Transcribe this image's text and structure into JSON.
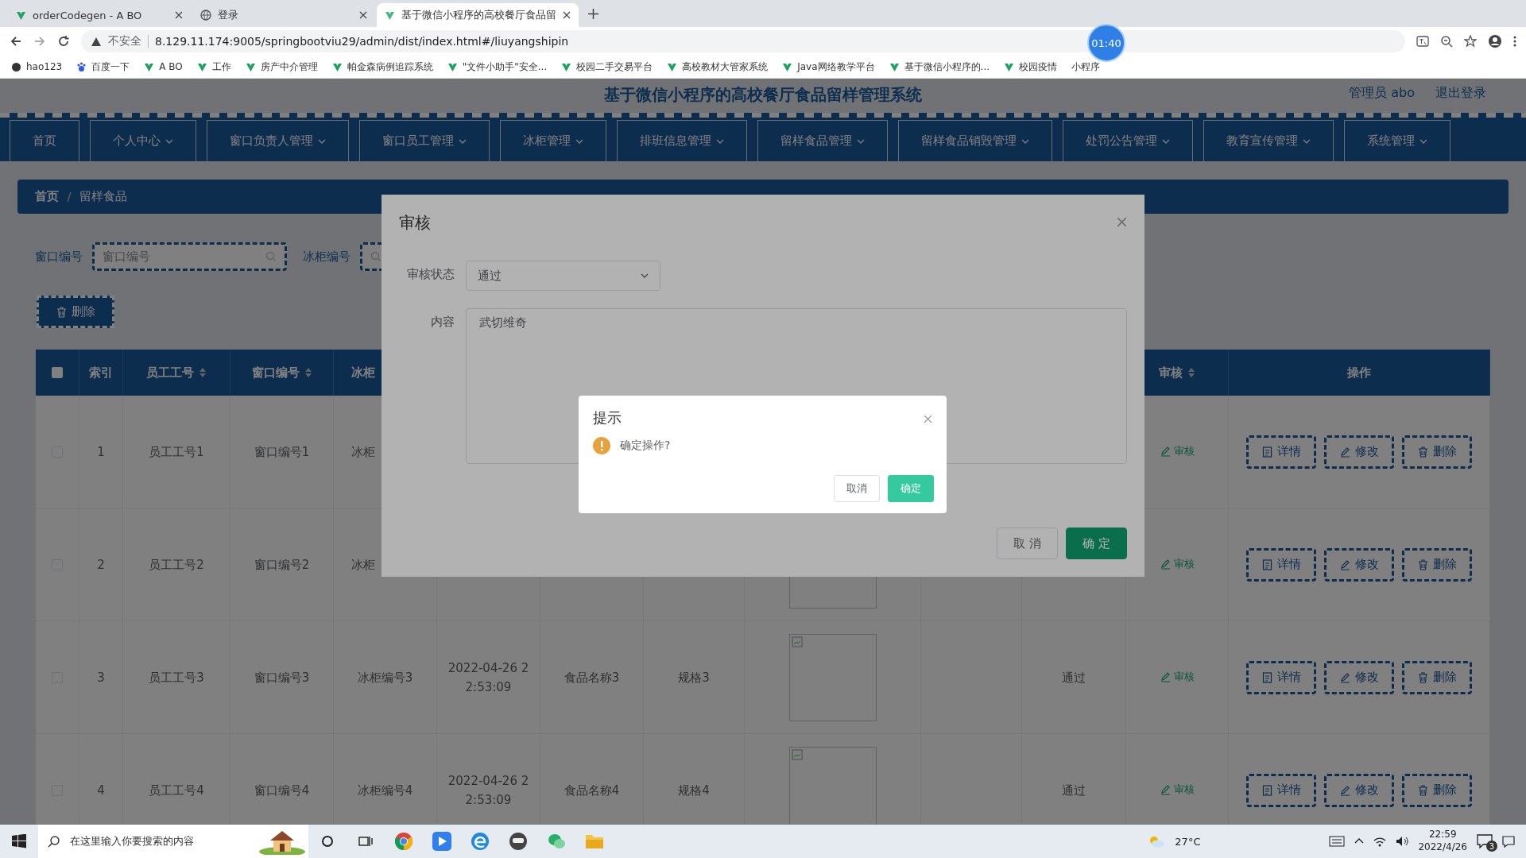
{
  "browser": {
    "tabs": [
      {
        "title": "orderCodegen - A BO",
        "selected": false
      },
      {
        "title": "登录",
        "selected": false
      },
      {
        "title": "基于微信小程序的高校餐厅食品留",
        "selected": true
      }
    ],
    "security": "不安全",
    "url": "8.129.11.174:9005/springbootviu29/admin/dist/index.html#/liuyangshipin",
    "bookmarks": [
      "hao123",
      "百度一下",
      "A BO",
      "工作",
      "房产中介管理",
      "帕金森病例追踪系统",
      "\"文件小助手\"安全...",
      "校园二手交易平台",
      "高校教材大管家系统",
      "Java网络教学平台",
      "基于微信小程序的...",
      "校园疫情",
      "小程序"
    ],
    "recording_timer": "01:40"
  },
  "header": {
    "title": "基于微信小程序的高校餐厅食品留样管理系统",
    "user": "管理员 abo",
    "logout": "退出登录"
  },
  "nav": [
    {
      "label": "首页",
      "dropdown": false
    },
    {
      "label": "个人中心",
      "dropdown": true
    },
    {
      "label": "窗口负责人管理",
      "dropdown": true
    },
    {
      "label": "窗口员工管理",
      "dropdown": true
    },
    {
      "label": "冰柜管理",
      "dropdown": true
    },
    {
      "label": "排班信息管理",
      "dropdown": true
    },
    {
      "label": "留样食品管理",
      "dropdown": true
    },
    {
      "label": "留样食品销毁管理",
      "dropdown": true
    },
    {
      "label": "处罚公告管理",
      "dropdown": true
    },
    {
      "label": "教育宣传管理",
      "dropdown": true
    },
    {
      "label": "系统管理",
      "dropdown": true
    }
  ],
  "breadcrumb": [
    "首页",
    "留样食品"
  ],
  "search": [
    {
      "label": "窗口编号",
      "placeholder": "窗口编号"
    },
    {
      "label": "冰柜编号"
    }
  ],
  "delete_button": "删除",
  "table": {
    "header": {
      "checked": false,
      "index": {
        "label": "索引",
        "sortable": false
      },
      "staff_no": {
        "label": "员工工号",
        "sortable": true
      },
      "window_no": {
        "label": "窗口编号",
        "sortable": true
      },
      "freezer_no": {
        "label": "冰柜"
      },
      "review": {
        "label": "审核",
        "sortable": true
      },
      "actions": {
        "label": "操作",
        "sortable": false
      }
    },
    "rows": [
      {
        "checked": false,
        "index": "1",
        "staff_no": "员工工号1",
        "window_no": "窗口编号1",
        "freezer_no": "冰柜",
        "review_link": "审核",
        "actions": [
          "详情",
          "修改",
          "删除"
        ]
      },
      {
        "checked": false,
        "index": "2",
        "staff_no": "员工工号2",
        "window_no": "窗口编号2",
        "freezer_no": "冰柜",
        "image": {
          "kind": "broken"
        },
        "review_link": "审核",
        "actions": [
          "详情",
          "修改",
          "删除"
        ]
      },
      {
        "checked": false,
        "index": "3",
        "staff_no": "员工工号3",
        "window_no": "窗口编号3",
        "freezer_no": "冰柜编号3",
        "date": "2022-04-26 22:53:09",
        "food": "食品名称3",
        "spec": "规格3",
        "image": {
          "kind": "broken"
        },
        "status": "通过",
        "review_link": "审核",
        "actions": [
          "详情",
          "修改",
          "删除"
        ]
      },
      {
        "checked": false,
        "index": "4",
        "staff_no": "员工工号4",
        "window_no": "窗口编号4",
        "freezer_no": "冰柜编号4",
        "date": "2022-04-26 22:53:09",
        "food": "食品名称4",
        "spec": "规格4",
        "image": {
          "kind": "broken"
        },
        "status": "通过",
        "review_link": "审核",
        "actions": [
          "详情",
          "修改",
          "删除"
        ]
      }
    ]
  },
  "review_dialog": {
    "title": "审核",
    "fields": [
      {
        "label": "审核状态",
        "kind": "select",
        "value": "通过"
      },
      {
        "label": "内容",
        "kind": "textarea",
        "value": "武切维奇"
      }
    ],
    "buttons": [
      {
        "label": "取 消",
        "primary": false
      },
      {
        "label": "确 定",
        "primary": true
      }
    ]
  },
  "confirm_dialog": {
    "title": "提示",
    "message": "确定操作?",
    "buttons": [
      {
        "label": "取消",
        "primary": false
      },
      {
        "label": "确定",
        "primary": true
      }
    ]
  },
  "taskbar": {
    "search_placeholder": "在这里输入你要搜索的内容",
    "weather": "27°C",
    "time": "22:59",
    "date": "2022/4/26",
    "notifications": "3"
  }
}
